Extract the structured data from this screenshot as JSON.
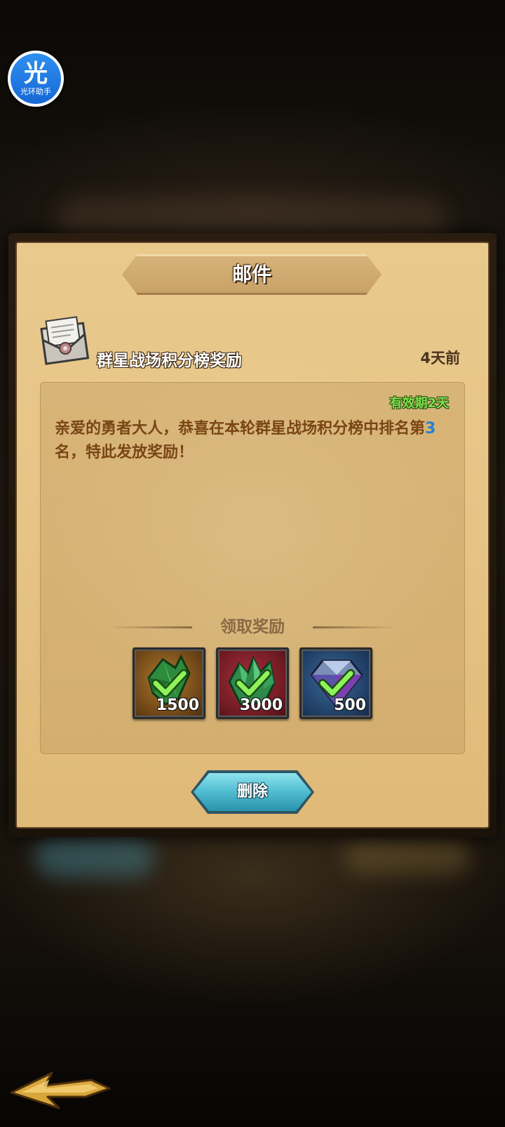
{
  "assistant_badge": {
    "glyph": "光",
    "caption": "光环助手",
    "color": "#1c74e0"
  },
  "mail_panel": {
    "title": "邮件",
    "subject": "群星战场积分榜奖励",
    "age": "4天前",
    "validity": "有效期2天",
    "message_part1": "亲爱的勇者大人，恭喜在本轮群星战场积分榜中排名第",
    "rank_number": "3",
    "message_part2": "名，特此发放奖励！",
    "rewards_header": "领取奖励",
    "rewards": [
      {
        "icon": "green-crystal-icon",
        "quantity": "1500",
        "claimed": true
      },
      {
        "icon": "green-crystal-cluster-icon",
        "quantity": "3000",
        "claimed": true
      },
      {
        "icon": "diamond-icon",
        "quantity": "500",
        "claimed": true
      }
    ],
    "delete_label": "删除"
  },
  "colors": {
    "paper": "#e6c486",
    "message_text": "#7a4516",
    "rank_highlight": "#2a7fd6",
    "validity_text": "#7ee04b",
    "delete_button": "#4fbcd0"
  },
  "navigation": {
    "back_icon": "back-arrow-icon"
  }
}
